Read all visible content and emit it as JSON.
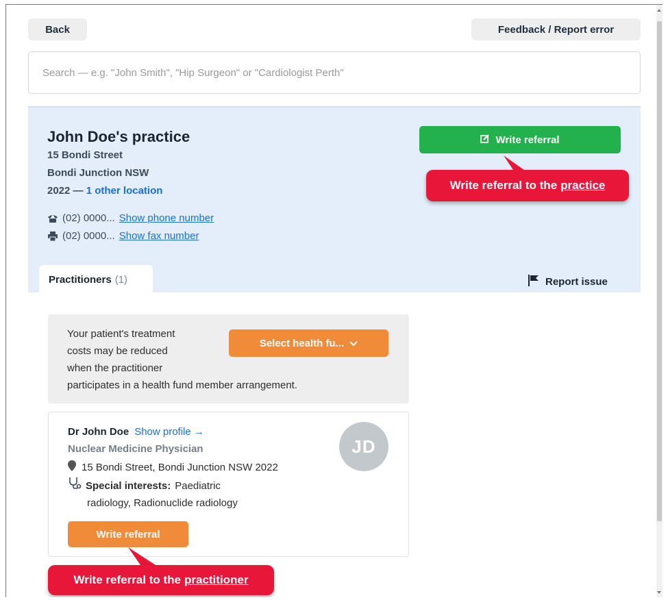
{
  "header": {
    "back_label": "Back",
    "feedback_label": "Feedback / Report error"
  },
  "search": {
    "placeholder": "Search — e.g. \"John Smith\", \"Hip Surgeon\" or \"Cardiologist Perth\""
  },
  "practice": {
    "name": "John Doe's practice",
    "street": "15 Bondi Street",
    "suburb": "Bondi Junction NSW",
    "postcode": "2022",
    "postcode_sep": " — ",
    "other_locations": "1 other location",
    "phone_partial": "(02) 0000...",
    "phone_link": "Show phone number",
    "fax_partial": "(02) 0000...",
    "fax_link": "Show fax number",
    "write_referral_label": "Write referral"
  },
  "callouts": {
    "practice_prefix": "Write referral to the",
    "practice_target": "practice",
    "practitioner_prefix": "Write referral to the",
    "practitioner_target": "practitioner"
  },
  "tabs": {
    "practitioners_label": "Practitioners",
    "practitioners_count": "(1)",
    "report_issue_label": "Report issue"
  },
  "health_fund": {
    "text_lines": [
      "Your patient's treatment",
      "costs may be reduced",
      "when the practitioner",
      "participates in a health fund member arrangement."
    ],
    "select_label": "Select health fu..."
  },
  "practitioner": {
    "name": "Dr John Doe",
    "profile_link": "Show profile →",
    "specialty": "Nuclear Medicine Physician",
    "address": "15 Bondi Street, Bondi Junction NSW 2022",
    "interests_label": "Special interests:",
    "interests_value_1": "Paediatric",
    "interests_value_2": "radiology, Radionuclide radiology",
    "initials": "JD",
    "write_referral_label": "Write referral"
  },
  "colors": {
    "green": "#22b14c",
    "orange": "#f08b3a",
    "callout_red": "#e8173a",
    "panel_blue": "#e4eefb",
    "link_blue": "#1a6fd6"
  }
}
